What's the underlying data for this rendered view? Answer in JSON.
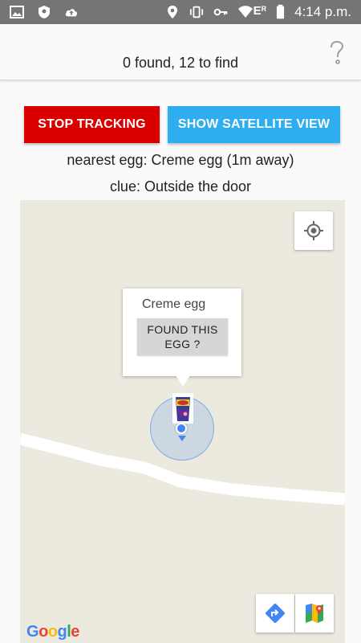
{
  "status_bar": {
    "time": "4:14 p.m.",
    "network_label": "E",
    "network_superscript": "R",
    "icons": [
      "image-icon",
      "shield-icon",
      "upload-icon",
      "location-icon",
      "vibrate-icon",
      "key-icon",
      "wifi-icon",
      "signal-icon",
      "battery-icon"
    ]
  },
  "header": {
    "title": "0 found, 12 to find",
    "help_icon": "help-icon"
  },
  "buttons": {
    "stop_tracking": "STOP TRACKING",
    "satellite_view": "SHOW SATELLITE VIEW"
  },
  "info": {
    "nearest": "nearest egg: Creme egg (1m away)",
    "clue": "clue: Outside the door"
  },
  "map": {
    "info_window": {
      "title": "Creme egg",
      "found_button": "FOUND THIS EGG ?"
    },
    "controls": [
      "my-location-icon",
      "directions-icon",
      "google-maps-icon"
    ],
    "google_logo": [
      "G",
      "o",
      "o",
      "g",
      "l",
      "e"
    ],
    "google_logo_colors": [
      "#4285f4",
      "#ea4335",
      "#fbbc05",
      "#4285f4",
      "#34a853",
      "#ea4335"
    ]
  },
  "colors": {
    "stop_button": "#db0000",
    "satellite_button": "#2eaef0",
    "map_background": "#ece9df",
    "location_blue": "#4285f4"
  }
}
